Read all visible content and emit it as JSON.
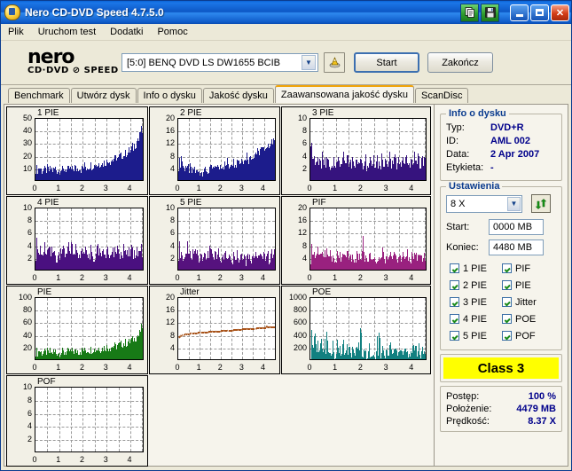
{
  "window": {
    "title": "Nero CD-DVD Speed 4.7.5.0",
    "icon": "nero-app-icon",
    "toolbar_buttons": [
      {
        "name": "copy-to-clipboard-button",
        "icon": "copy-icon"
      },
      {
        "name": "save-button",
        "icon": "floppy-disk-icon"
      }
    ],
    "controls": [
      {
        "name": "minimize-button",
        "label": "_"
      },
      {
        "name": "maximize-button",
        "label": "□"
      },
      {
        "name": "close-button",
        "label": "✕"
      }
    ]
  },
  "menu": [
    "Plik",
    "Uruchom test",
    "Dodatki",
    "Pomoc"
  ],
  "logo": {
    "line1": "nero",
    "line2": "CD·DVD ⊘ SPEED"
  },
  "drive": {
    "value": "[5:0]   BENQ DVD LS DW1655 BCIB",
    "eject_icon": "eject-disc-icon"
  },
  "buttons": {
    "start": "Start",
    "stop": "Zakończ"
  },
  "tabs": [
    {
      "label": "Benchmark",
      "active": false
    },
    {
      "label": "Utwórz dysk",
      "active": false
    },
    {
      "label": "Info o dysku",
      "active": false
    },
    {
      "label": "Jakość dysku",
      "active": false
    },
    {
      "label": "Zaawansowana jakość dysku",
      "active": true
    },
    {
      "label": "ScanDisc",
      "active": false
    }
  ],
  "disc_info": {
    "caption": "Info o dysku",
    "rows": [
      {
        "key": "Typ:",
        "value": "DVD+R"
      },
      {
        "key": "ID:",
        "value": "AML 002"
      },
      {
        "key": "Data:",
        "value": "2 Apr 2007"
      },
      {
        "key": "Etykieta:",
        "value": "-"
      }
    ]
  },
  "settings": {
    "caption": "Ustawienia",
    "speed": "8 X",
    "refresh_icon": "refresh-icon",
    "start_label": "Start:",
    "start_value": "0000 MB",
    "end_label": "Koniec:",
    "end_value": "4480 MB",
    "checkboxes": [
      {
        "label": "1 PIE",
        "checked": true
      },
      {
        "label": "PIF",
        "checked": true
      },
      {
        "label": "2 PIE",
        "checked": true
      },
      {
        "label": "PIE",
        "checked": true
      },
      {
        "label": "3 PIE",
        "checked": true
      },
      {
        "label": "Jitter",
        "checked": true
      },
      {
        "label": "4 PIE",
        "checked": true
      },
      {
        "label": "POE",
        "checked": true
      },
      {
        "label": "5 PIE",
        "checked": true
      },
      {
        "label": "POF",
        "checked": true
      }
    ]
  },
  "quality_class": "Class 3",
  "status": {
    "rows": [
      {
        "key": "Postęp:",
        "value": "100 %"
      },
      {
        "key": "Położenie:",
        "value": "4479 MB"
      },
      {
        "key": "Prędkość:",
        "value": "8.37 X"
      }
    ]
  },
  "chart_data": [
    {
      "type": "area",
      "title": "1 PIE",
      "color": "#1c1c8c",
      "ylim": [
        0,
        50
      ],
      "yticks": [
        10,
        20,
        30,
        40,
        50
      ],
      "xlim": [
        0,
        4.6
      ],
      "xticks": [
        0,
        1,
        2,
        3,
        4
      ],
      "xlabel": "",
      "ylabel": "",
      "grid": true,
      "values": [
        8,
        9,
        7,
        10,
        9,
        8,
        7,
        9,
        8,
        7,
        8,
        9,
        7,
        8,
        9,
        8,
        7,
        8,
        9,
        8,
        7,
        8,
        7,
        9,
        8,
        7,
        8,
        9,
        8,
        7,
        8,
        9,
        8,
        7,
        9,
        8,
        10,
        9,
        8,
        9,
        10,
        9,
        8,
        10,
        9,
        11,
        10,
        9,
        11,
        10,
        12,
        11,
        10,
        12,
        11,
        13,
        12,
        11,
        13,
        12,
        14,
        13,
        12,
        14,
        13,
        15,
        14,
        16,
        15,
        14,
        16,
        15,
        17,
        16,
        18,
        17,
        16,
        18,
        19,
        18,
        20,
        19,
        21,
        20,
        22,
        21,
        23,
        22,
        24,
        26,
        25,
        28,
        27,
        30,
        33,
        31,
        36,
        40,
        38,
        42
      ]
    },
    {
      "type": "area",
      "title": "2 PIE",
      "color": "#1c1c8c",
      "ylim": [
        0,
        20
      ],
      "yticks": [
        4,
        8,
        12,
        16,
        20
      ],
      "xlim": [
        0,
        4.6
      ],
      "xticks": [
        0,
        1,
        2,
        3,
        4
      ],
      "xlabel": "",
      "ylabel": "",
      "grid": true,
      "values": [
        4,
        6,
        5,
        8,
        5,
        4,
        3,
        5,
        4,
        3,
        4,
        3,
        4,
        3,
        2,
        3,
        4,
        3,
        2,
        3,
        2,
        3,
        2,
        3,
        2,
        3,
        4,
        3,
        2,
        3,
        2,
        3,
        4,
        3,
        4,
        3,
        4,
        3,
        4,
        5,
        4,
        3,
        4,
        5,
        4,
        5,
        4,
        5,
        4,
        5,
        6,
        5,
        4,
        5,
        6,
        5,
        6,
        5,
        6,
        5,
        6,
        7,
        6,
        5,
        6,
        7,
        6,
        7,
        6,
        7,
        8,
        7,
        6,
        7,
        8,
        7,
        8,
        7,
        8,
        9,
        8,
        9,
        8,
        9,
        10,
        9,
        10,
        9,
        10,
        11,
        10,
        11,
        10,
        12,
        11,
        12,
        11,
        13,
        12,
        12
      ]
    },
    {
      "type": "area",
      "title": "3 PIE",
      "color": "#36137e",
      "ylim": [
        0,
        10
      ],
      "yticks": [
        2,
        4,
        6,
        8,
        10
      ],
      "xlim": [
        0,
        4.6
      ],
      "xticks": [
        0,
        1,
        2,
        3,
        4
      ],
      "xlabel": "",
      "ylabel": "",
      "grid": true,
      "values": [
        6,
        5,
        3,
        4,
        2,
        3,
        4,
        2,
        3,
        2,
        4,
        2,
        3,
        2,
        4,
        3,
        2,
        1,
        3,
        2,
        4,
        2,
        3,
        2,
        4,
        2,
        3,
        2,
        4,
        3,
        2,
        3,
        4,
        2,
        3,
        2,
        4,
        3,
        2,
        4,
        2,
        3,
        2,
        4,
        3,
        2,
        3,
        4,
        2,
        3,
        2,
        4,
        3,
        2,
        4,
        2,
        3,
        4,
        2,
        3,
        2,
        4,
        3,
        2,
        4,
        3,
        2,
        3,
        4,
        2,
        3,
        2,
        4,
        3,
        2,
        4,
        3,
        2,
        3,
        4,
        2,
        3,
        4,
        2,
        3,
        2,
        4,
        3,
        2,
        4,
        3,
        2,
        4,
        3,
        2,
        3,
        4,
        2,
        4,
        3
      ]
    },
    {
      "type": "area",
      "title": "4 PIE",
      "color": "#4a1080",
      "ylim": [
        0,
        10
      ],
      "yticks": [
        2,
        4,
        6,
        8,
        10
      ],
      "xlim": [
        0,
        4.6
      ],
      "xticks": [
        0,
        1,
        2,
        3,
        4
      ],
      "xlabel": "",
      "ylabel": "",
      "grid": true,
      "values": [
        2,
        5,
        3,
        2,
        4,
        2,
        3,
        2,
        4,
        2,
        3,
        2,
        4,
        3,
        2,
        4,
        2,
        3,
        2,
        1,
        2,
        3,
        2,
        4,
        2,
        3,
        4,
        2,
        3,
        2,
        4,
        3,
        2,
        5,
        2,
        3,
        2,
        4,
        3,
        2,
        3,
        2,
        4,
        2,
        3,
        2,
        4,
        3,
        2,
        3,
        2,
        4,
        3,
        2,
        1,
        2,
        3,
        5,
        2,
        4,
        3,
        2,
        4,
        2,
        3,
        2,
        4,
        3,
        2,
        3,
        2,
        4,
        2,
        3,
        2,
        4,
        3,
        2,
        1,
        3,
        2,
        4,
        3,
        2,
        4,
        2,
        3,
        2,
        4,
        3,
        2,
        3,
        2,
        4,
        2,
        3,
        2,
        4,
        2,
        3
      ]
    },
    {
      "type": "area",
      "title": "5 PIE",
      "color": "#56127e",
      "ylim": [
        0,
        10
      ],
      "yticks": [
        2,
        4,
        6,
        8,
        10
      ],
      "xlim": [
        0,
        4.6
      ],
      "xticks": [
        0,
        1,
        2,
        3,
        4
      ],
      "xlabel": "",
      "ylabel": "",
      "grid": true,
      "values": [
        2,
        4,
        2,
        3,
        2,
        1,
        2,
        3,
        2,
        4,
        2,
        3,
        2,
        1,
        2,
        3,
        2,
        4,
        2,
        3,
        2,
        1,
        2,
        3,
        2,
        2,
        3,
        2,
        1,
        2,
        3,
        2,
        4,
        2,
        3,
        2,
        1,
        2,
        3,
        2,
        2,
        3,
        2,
        1,
        2,
        3,
        2,
        2,
        3,
        2,
        1,
        2,
        3,
        2,
        2,
        1,
        2,
        3,
        2,
        2,
        3,
        2,
        1,
        2,
        3,
        2,
        2,
        3,
        2,
        1,
        2,
        3,
        2,
        2,
        1,
        2,
        3,
        2,
        2,
        3,
        2,
        1,
        2,
        3,
        2,
        2,
        1,
        2,
        3,
        2,
        2,
        3,
        2,
        1,
        2,
        3,
        2,
        2,
        3,
        2
      ]
    },
    {
      "type": "area",
      "title": "PIF",
      "color": "#99217f",
      "ylim": [
        0,
        20
      ],
      "yticks": [
        4,
        8,
        12,
        16,
        20
      ],
      "xlim": [
        0,
        4.6
      ],
      "xticks": [
        0,
        1,
        2,
        3,
        4
      ],
      "xlabel": "",
      "ylabel": "",
      "grid": true,
      "values": [
        3,
        8,
        4,
        6,
        3,
        5,
        8,
        4,
        3,
        6,
        4,
        3,
        5,
        4,
        7,
        3,
        4,
        6,
        3,
        5,
        3,
        4,
        2,
        5,
        3,
        6,
        3,
        4,
        3,
        5,
        3,
        4,
        6,
        3,
        4,
        3,
        5,
        3,
        4,
        3,
        6,
        3,
        4,
        3,
        5,
        12,
        4,
        3,
        5,
        3,
        4,
        6,
        3,
        4,
        3,
        5,
        3,
        2,
        4,
        3,
        5,
        3,
        9,
        4,
        3,
        5,
        3,
        4,
        3,
        6,
        3,
        4,
        5,
        3,
        4,
        3,
        5,
        3,
        4,
        6,
        3,
        4,
        3,
        5,
        3,
        4,
        3,
        6,
        3,
        4,
        5,
        3,
        4,
        3,
        7,
        4,
        3,
        5,
        3,
        4
      ]
    },
    {
      "type": "area",
      "title": "PIE",
      "color": "#177a16",
      "ylim": [
        0,
        100
      ],
      "yticks": [
        20,
        40,
        60,
        80,
        100
      ],
      "xlim": [
        0,
        4.6
      ],
      "xticks": [
        0,
        1,
        2,
        3,
        4
      ],
      "xlabel": "",
      "ylabel": "",
      "grid": true,
      "values": [
        10,
        12,
        9,
        14,
        11,
        10,
        9,
        12,
        10,
        9,
        11,
        10,
        9,
        12,
        10,
        9,
        11,
        10,
        12,
        9,
        11,
        10,
        9,
        12,
        10,
        11,
        9,
        12,
        10,
        11,
        10,
        12,
        11,
        10,
        13,
        11,
        12,
        11,
        13,
        12,
        11,
        13,
        12,
        14,
        13,
        12,
        14,
        13,
        15,
        14,
        13,
        15,
        14,
        16,
        15,
        14,
        16,
        15,
        17,
        16,
        15,
        17,
        16,
        18,
        17,
        19,
        18,
        17,
        19,
        18,
        20,
        19,
        21,
        20,
        19,
        22,
        21,
        23,
        22,
        24,
        23,
        25,
        24,
        26,
        25,
        27,
        26,
        28,
        30,
        29,
        32,
        31,
        35,
        34,
        38,
        37,
        42,
        46,
        52,
        48
      ]
    },
    {
      "type": "line",
      "title": "Jitter",
      "color": "#a8531a",
      "ylim": [
        0,
        20
      ],
      "yticks": [
        4,
        8,
        12,
        16,
        20
      ],
      "xlim": [
        0,
        4.6
      ],
      "xticks": [
        0,
        1,
        2,
        3,
        4
      ],
      "xlabel": "",
      "ylabel": "",
      "grid": true,
      "values": [
        7.6,
        7.9,
        8.1,
        8.3,
        8.4,
        8.5,
        8.6,
        8.6,
        8.7,
        8.7,
        8.8,
        8.8,
        8.9,
        8.9,
        9.0,
        9.0,
        9.0,
        9.1,
        9.1,
        9.1,
        9.2,
        9.2,
        9.2,
        9.3,
        9.3,
        9.3,
        9.3,
        9.4,
        9.4,
        9.4,
        9.4,
        9.5,
        9.5,
        9.5,
        9.5,
        9.6,
        9.6,
        9.6,
        9.6,
        9.7,
        9.7,
        9.7,
        9.7,
        9.8,
        9.8,
        9.8,
        9.8,
        9.9,
        9.9,
        9.9,
        9.9,
        10.0,
        10.0,
        10.0,
        10.0,
        10.0,
        10.1,
        10.1,
        10.1,
        10.1,
        10.1,
        10.2,
        10.2,
        10.2,
        10.2,
        10.3,
        10.3,
        10.3,
        10.3,
        10.3,
        10.4,
        10.4,
        10.4,
        10.4,
        10.5,
        10.5,
        10.5,
        10.5,
        10.5,
        10.6,
        10.6,
        10.6,
        10.6,
        10.7,
        10.7,
        10.7,
        10.7,
        10.8,
        10.8,
        10.8,
        11.4,
        10.9,
        10.9,
        10.9,
        11.0,
        11.0,
        11.0,
        11.0,
        11.0,
        11.0
      ]
    },
    {
      "type": "area",
      "title": "POE",
      "color": "#128080",
      "ylim": [
        0,
        1000
      ],
      "yticks": [
        200,
        400,
        600,
        800,
        1000
      ],
      "xlim": [
        0,
        4.6
      ],
      "xticks": [
        0,
        1,
        2,
        3,
        4
      ],
      "xlabel": "",
      "ylabel": "",
      "grid": true,
      "values": [
        60,
        500,
        90,
        380,
        420,
        70,
        340,
        60,
        80,
        420,
        50,
        60,
        300,
        70,
        550,
        60,
        90,
        70,
        60,
        320,
        60,
        50,
        70,
        260,
        60,
        230,
        80,
        70,
        290,
        60,
        50,
        200,
        70,
        280,
        60,
        50,
        220,
        180,
        60,
        260,
        70,
        300,
        60,
        730,
        70,
        60,
        250,
        90,
        60,
        70,
        300,
        60,
        50,
        60,
        70,
        60,
        50,
        380,
        60,
        580,
        70,
        60,
        290,
        80,
        60,
        210,
        70,
        60,
        180,
        260,
        70,
        60,
        150,
        90,
        200,
        60,
        170,
        60,
        250,
        70,
        60,
        230,
        80,
        60,
        70,
        60,
        190,
        70,
        310,
        60,
        240,
        70,
        60,
        190,
        80,
        60,
        230,
        70,
        60,
        260
      ]
    },
    {
      "type": "area",
      "title": "POF",
      "color": "#128080",
      "ylim": [
        0,
        10
      ],
      "yticks": [
        2,
        4,
        6,
        8,
        10
      ],
      "xlim": [
        0,
        4.6
      ],
      "xticks": [
        0,
        1,
        2,
        3,
        4
      ],
      "xlabel": "",
      "ylabel": "",
      "grid": true,
      "values": []
    }
  ]
}
